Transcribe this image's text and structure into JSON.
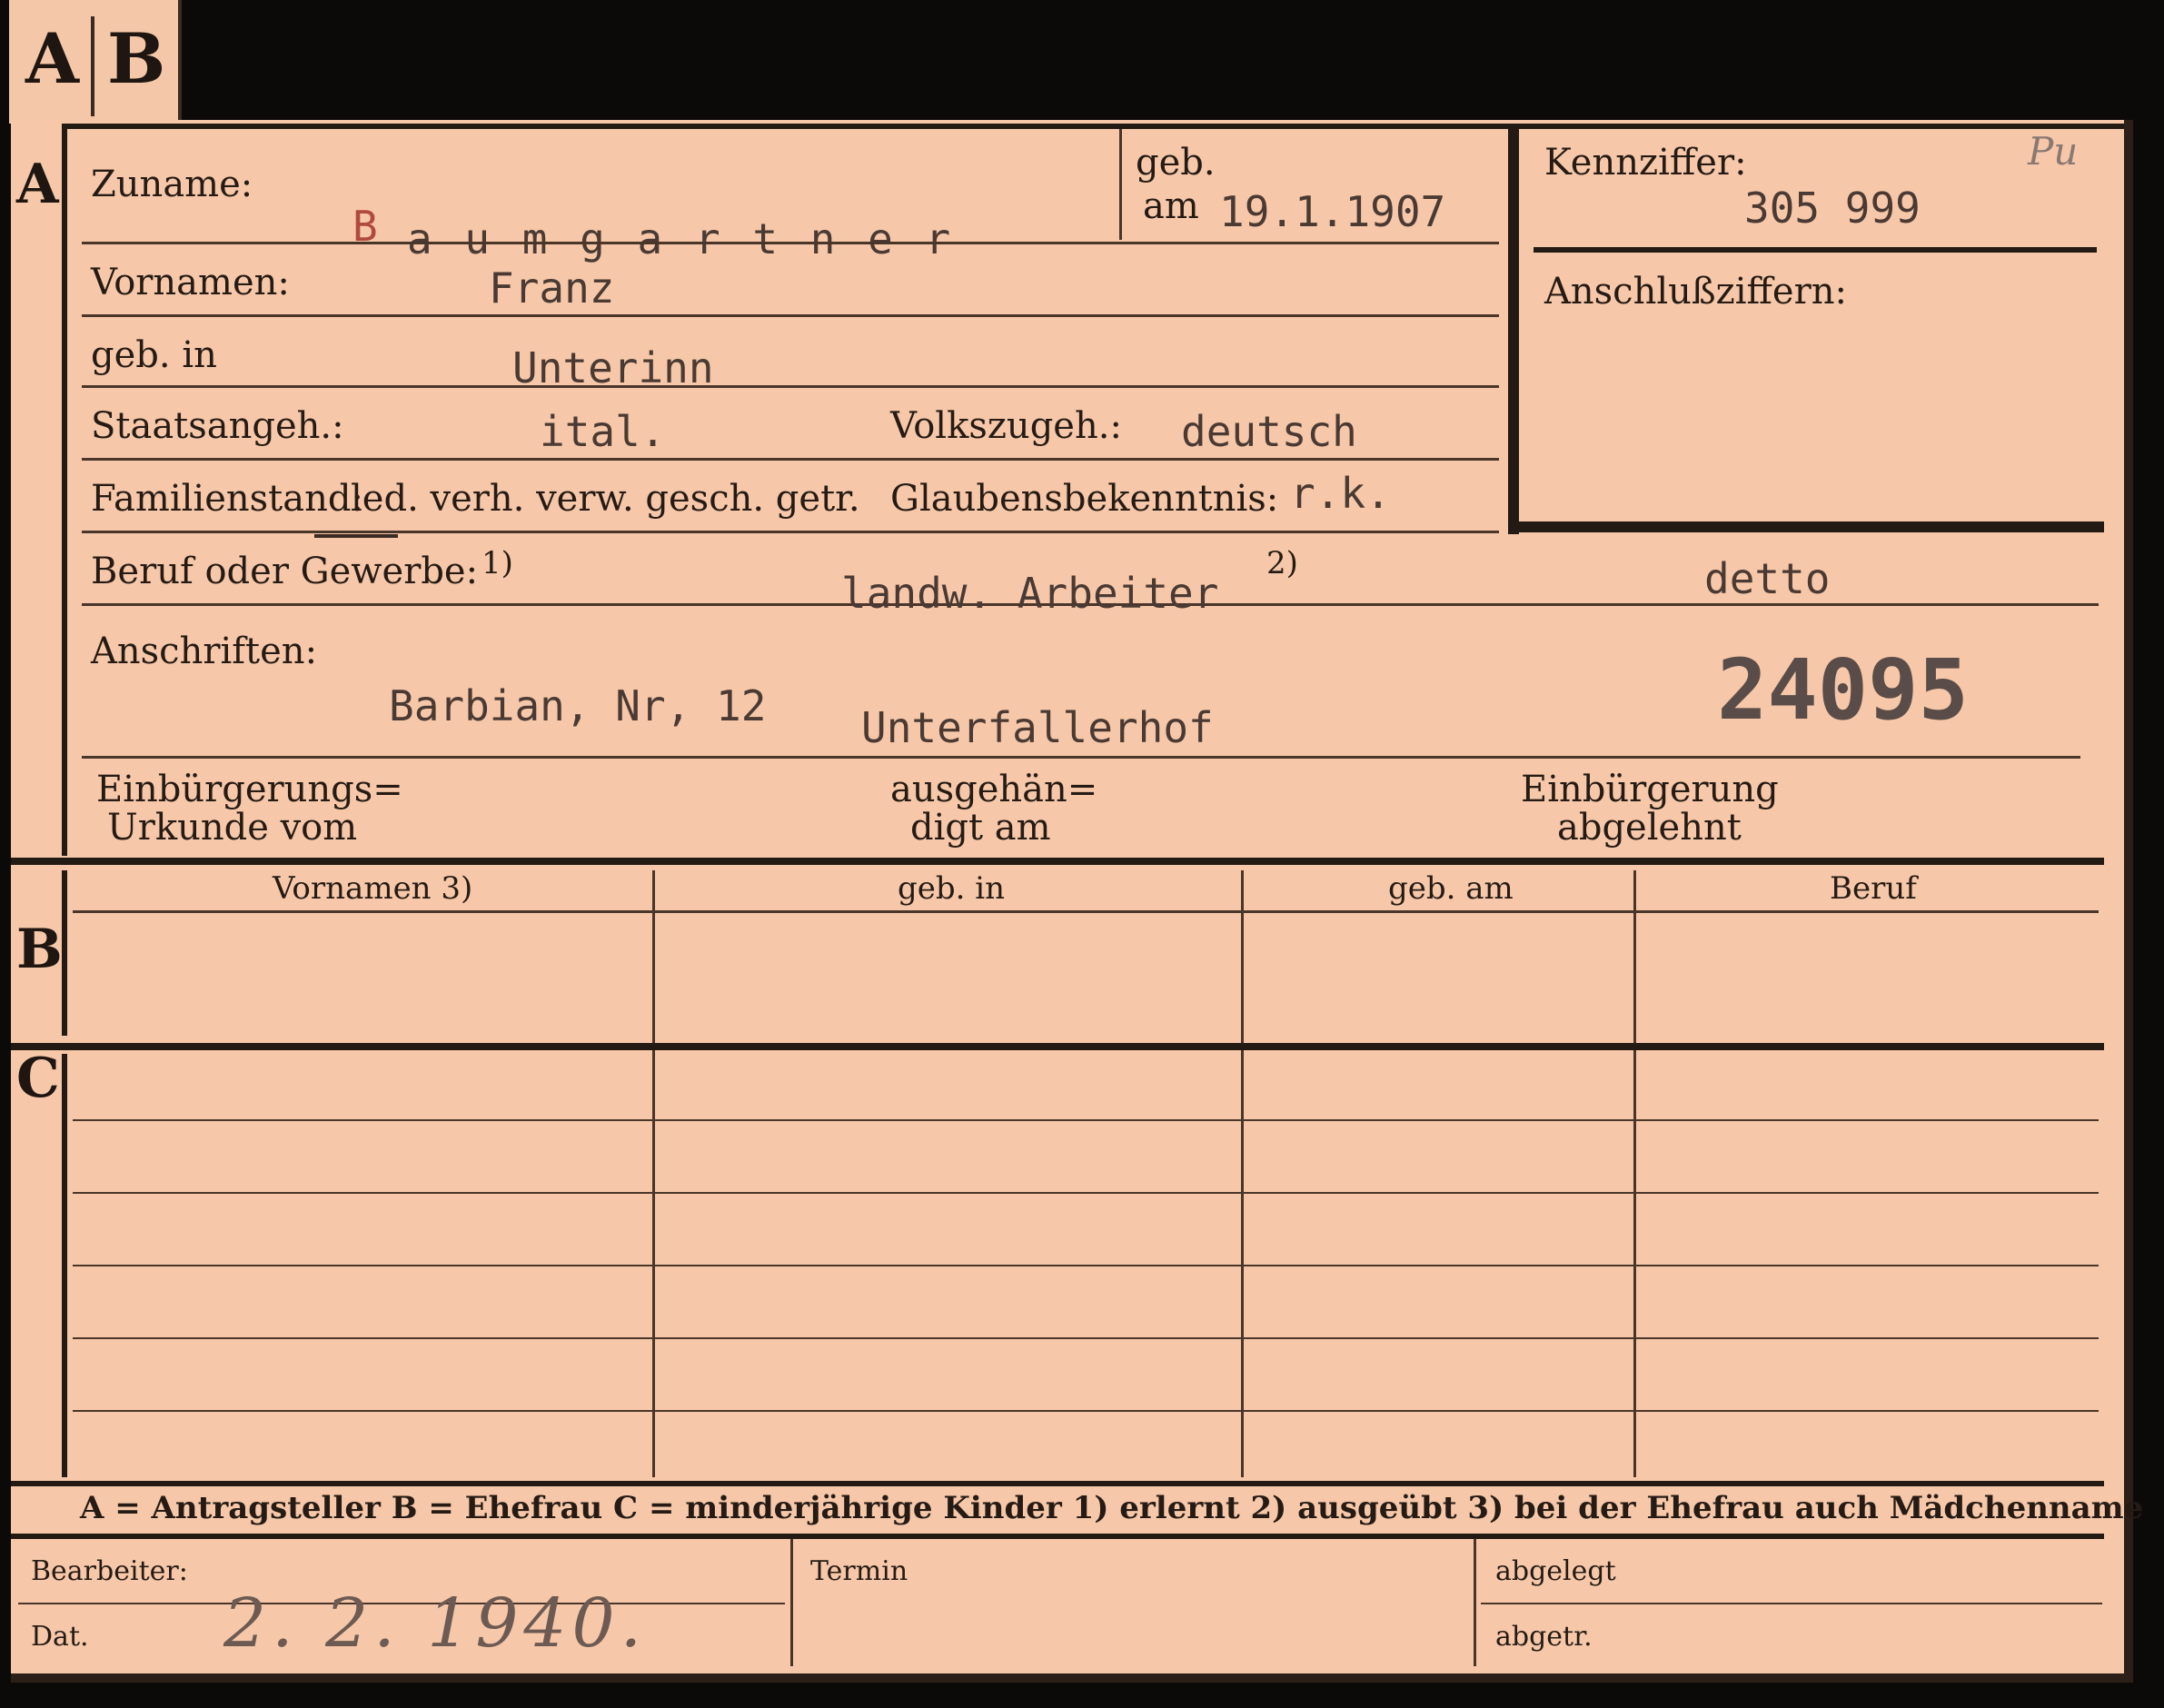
{
  "tab": {
    "letter_a": "A",
    "letter_b": "B"
  },
  "sections": {
    "a": "A",
    "b": "B",
    "c": "C"
  },
  "labels": {
    "zuname": "Zuname:",
    "geb": "geb.",
    "am": "am",
    "kennziffer": "Kennziffer:",
    "anschluss": "Anschlußziffern:",
    "vornamen": "Vornamen:",
    "geb_in": "geb. in",
    "staatsangeh": "Staatsangeh.:",
    "volkszugeh": "Volkszugeh.:",
    "familienstand": "Familienstand:",
    "familienstand_options": "led. verh. verw. gesch. getr.",
    "glaubens": "Glaubensbekenntnis:",
    "beruf": "Beruf oder Gewerbe:",
    "beruf_fn1": "1)",
    "beruf_fn2": "2)",
    "anschriften": "Anschriften:",
    "einb_urkunde_1": "Einbürgerungs=",
    "einb_urkunde_2": "Urkunde vom",
    "ausgehaen_1": "ausgehän=",
    "ausgehaen_2": "digt am",
    "einb_abgel_1": "Einbürgerung",
    "einb_abgel_2": "abgelehnt"
  },
  "values": {
    "surname_first": "B",
    "surname_rest": "a u m g a r t n e r",
    "birth_date": "19.1.1907",
    "kennziffer_note": "Pu",
    "kennziffer": "305 999",
    "firstname": "Franz",
    "birthplace": "Unterinn",
    "citizenship": "ital.",
    "ethnicity": "deutsch",
    "religion": "r.k.",
    "occupation_learned": "landw. Arbeiter",
    "occupation_practised": "detto",
    "address_1": "Barbian, Nr, 12",
    "address_2": "Unterfallerhof",
    "stamp_number": "24095"
  },
  "table_b": {
    "headers": [
      "Vornamen 3)",
      "geb. in",
      "geb. am",
      "Beruf"
    ]
  },
  "legend": {
    "text": "A = Antragsteller   B = Ehefrau   C = minderjährige Kinder   1) erlernt    2) ausgeübt    3) bei der Ehefrau auch Mädchenname"
  },
  "footer": {
    "bearbeiter": "Bearbeiter:",
    "dat": "Dat.",
    "date_handwritten": "2. 2. 1940.",
    "termin": "Termin",
    "abgelegt": "abgelegt",
    "abgetr": "abgetr."
  }
}
